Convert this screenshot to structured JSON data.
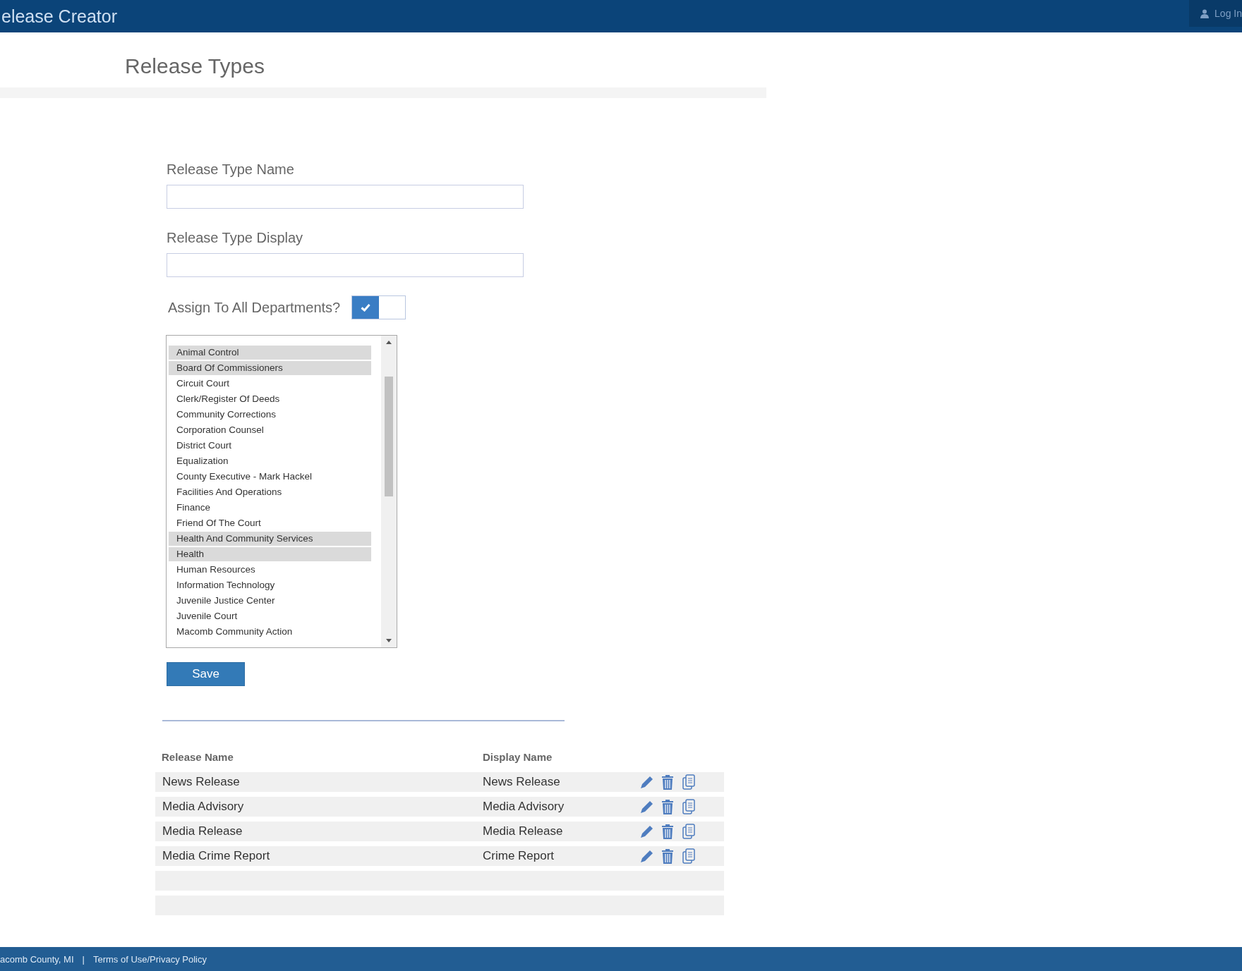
{
  "header": {
    "title": "elease Creator",
    "login": "Log In"
  },
  "page_title": "Release Types",
  "form": {
    "name_label": "Release Type Name",
    "display_label": "Release Type Display",
    "assign_label": "Assign To All Departments?",
    "assign_on": true,
    "departments": [
      {
        "label": "Animal Control",
        "selected": true
      },
      {
        "label": "Board Of Commissioners",
        "selected": true
      },
      {
        "label": "Circuit Court",
        "selected": false
      },
      {
        "label": "Clerk/Register Of Deeds",
        "selected": false
      },
      {
        "label": "Community Corrections",
        "selected": false
      },
      {
        "label": "Corporation Counsel",
        "selected": false
      },
      {
        "label": "District Court",
        "selected": false
      },
      {
        "label": "Equalization",
        "selected": false
      },
      {
        "label": "County Executive - Mark Hackel",
        "selected": false
      },
      {
        "label": "Facilities And Operations",
        "selected": false
      },
      {
        "label": "Finance",
        "selected": false
      },
      {
        "label": "Friend Of The Court",
        "selected": false
      },
      {
        "label": "Health And Community Services",
        "selected": true
      },
      {
        "label": "Health",
        "selected": true
      },
      {
        "label": "Human Resources",
        "selected": false
      },
      {
        "label": "Information Technology",
        "selected": false
      },
      {
        "label": "Juvenile Justice Center",
        "selected": false
      },
      {
        "label": "Juvenile Court",
        "selected": false
      },
      {
        "label": "Macomb Community Action",
        "selected": false
      }
    ],
    "save": "Save"
  },
  "table": {
    "columns": [
      "Release Name",
      "Display Name"
    ],
    "rows": [
      {
        "name": "News Release",
        "display": "News Release"
      },
      {
        "name": "Media Advisory",
        "display": "Media Advisory"
      },
      {
        "name": "Media Release",
        "display": "Media Release"
      },
      {
        "name": "Media Crime Report",
        "display": "Crime Report"
      }
    ]
  },
  "footer": {
    "county": "acomb County, MI",
    "separator": "|",
    "link": "Terms of Use/Privacy Policy"
  }
}
